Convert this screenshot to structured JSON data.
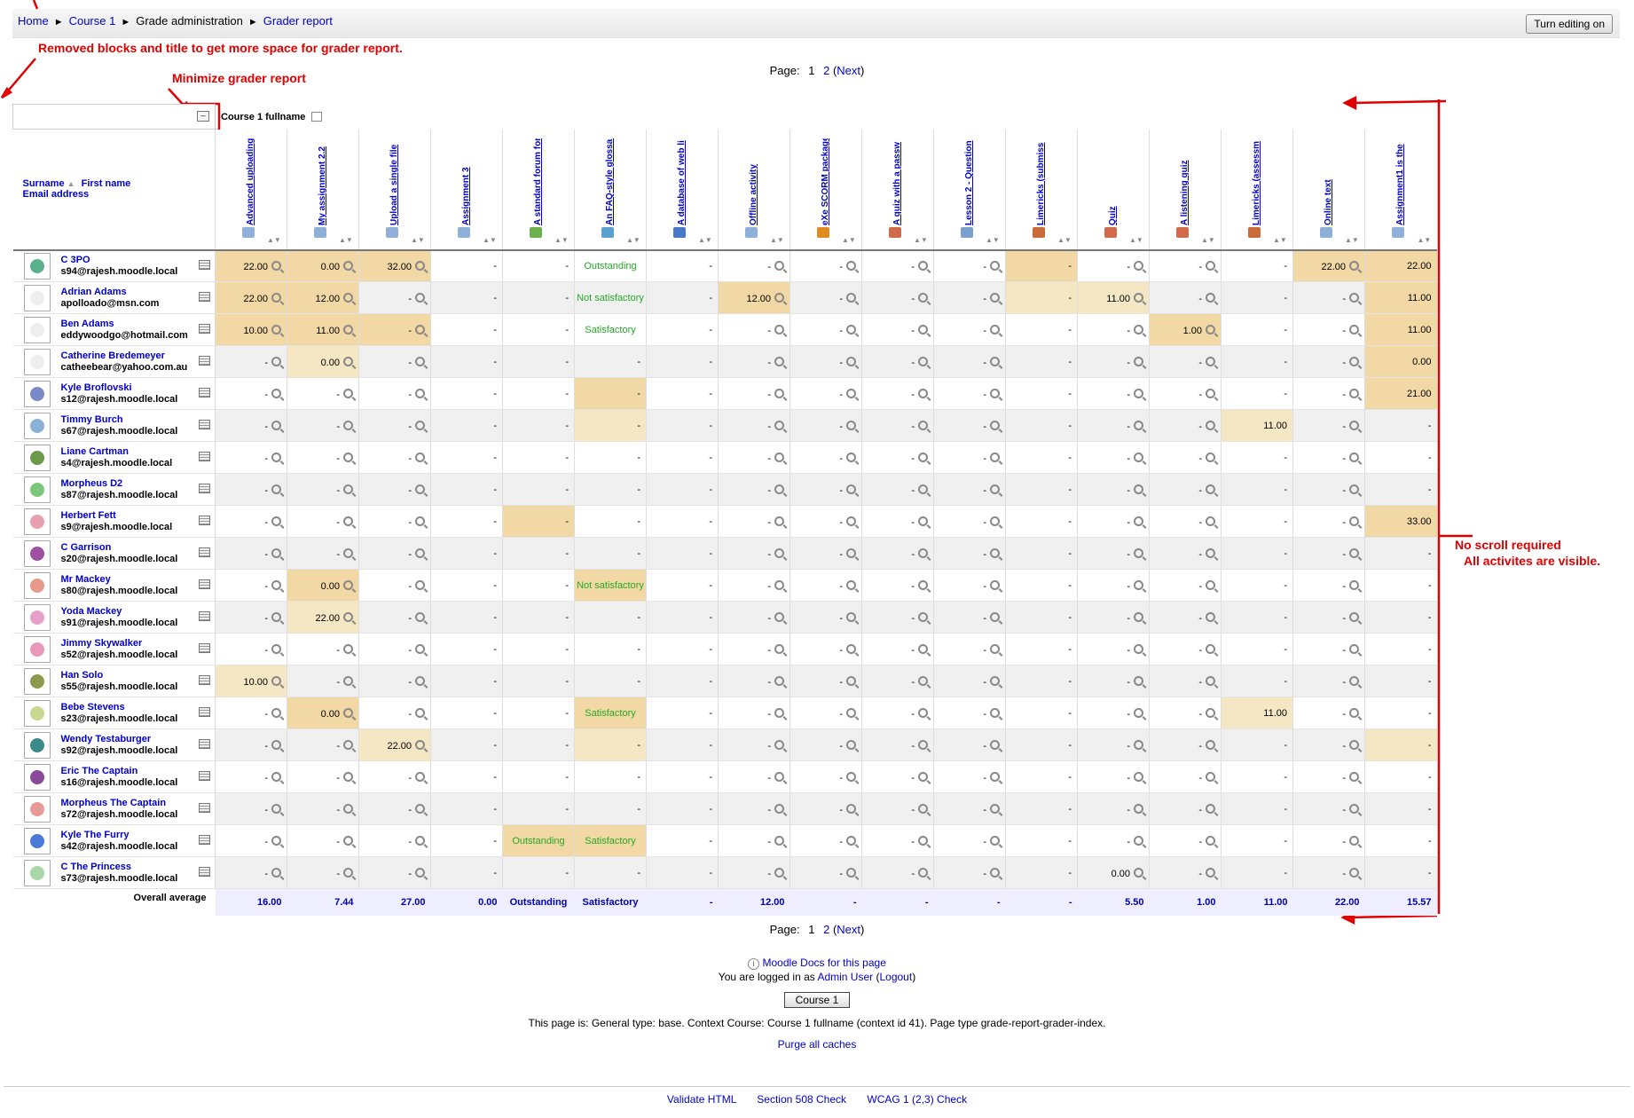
{
  "breadcrumb": [
    "Home",
    "Course 1",
    "Grade administration",
    "Grader report"
  ],
  "turn_editing_label": "Turn editing on",
  "annotations": {
    "removed_blocks": "Removed blocks and title to get more space for grader report.",
    "minimize": "Minimize grader report",
    "no_scroll_1": "No scroll required",
    "no_scroll_2": "All activites are visible."
  },
  "paging": {
    "label": "Page:",
    "current": "1",
    "page2": "2",
    "next": "Next"
  },
  "course_fullname": "Course 1 fullname",
  "user_header": {
    "surname": "Surname",
    "firstname": "First name",
    "email": "Email address"
  },
  "items": [
    {
      "name": "Advanced uploading",
      "icon_color": "#8fb0d8"
    },
    {
      "name": "My assignment 2.2",
      "icon_color": "#8fb0d8"
    },
    {
      "name": "Upload a single file",
      "icon_color": "#8fb0d8"
    },
    {
      "name": "Assignment 3",
      "icon_color": "#8fb0d8"
    },
    {
      "name": "A standard forum for",
      "icon_color": "#6bb04a"
    },
    {
      "name": "An FAQ-style glossary",
      "icon_color": "#5aa0d0"
    },
    {
      "name": "A database of web li",
      "icon_color": "#4a78c8"
    },
    {
      "name": "Offline activity",
      "icon_color": "#8fb0d8"
    },
    {
      "name": "eXe SCORM package",
      "icon_color": "#e08a20"
    },
    {
      "name": "A quiz with a passw",
      "icon_color": "#d06a4a"
    },
    {
      "name": "Lesson 2 - Question",
      "icon_color": "#7aa0d0"
    },
    {
      "name": "Limericks (submiss",
      "icon_color": "#c86a3a"
    },
    {
      "name": "Quiz",
      "icon_color": "#d06a4a"
    },
    {
      "name": "A listening quiz",
      "icon_color": "#d06a4a"
    },
    {
      "name": "Limericks (assessm",
      "icon_color": "#c86a3a"
    },
    {
      "name": "Online text",
      "icon_color": "#8fb0d8"
    },
    {
      "name": "Assignment1 is the",
      "icon_color": "#8fb0d8"
    }
  ],
  "users": [
    {
      "name": "C 3PO",
      "email": "s94@rajesh.moodle.local",
      "avatar": "#5ab08a",
      "grades": [
        "22.00",
        "0.00",
        "32.00",
        "-",
        "-",
        "Outstanding",
        "-",
        "-",
        "-",
        "-",
        "-",
        "-",
        "-",
        "-",
        "-",
        "22.00",
        "22.00"
      ]
    },
    {
      "name": "Adrian Adams",
      "email": "apolloado@msn.com",
      "avatar": "#eeeeee",
      "grades": [
        "22.00",
        "12.00",
        "-",
        "-",
        "-",
        "Not satisfactory",
        "-",
        "12.00",
        "-",
        "-",
        "-",
        "-",
        "11.00",
        "-",
        "-",
        "-",
        "11.00"
      ]
    },
    {
      "name": "Ben Adams",
      "email": "eddywoodgo@hotmail.com",
      "avatar": "#eeeeee",
      "grades": [
        "10.00",
        "11.00",
        "-",
        "-",
        "-",
        "Satisfactory",
        "-",
        "-",
        "-",
        "-",
        "-",
        "-",
        "-",
        "1.00",
        "-",
        "-",
        "11.00"
      ]
    },
    {
      "name": "Catherine Bredemeyer",
      "email": "catheebear@yahoo.com.au",
      "avatar": "#eeeeee",
      "grades": [
        "-",
        "0.00",
        "-",
        "-",
        "-",
        "-",
        "-",
        "-",
        "-",
        "-",
        "-",
        "-",
        "-",
        "-",
        "-",
        "-",
        "0.00"
      ]
    },
    {
      "name": "Kyle Broflovski",
      "email": "s12@rajesh.moodle.local",
      "avatar": "#7a8ac8",
      "grades": [
        "-",
        "-",
        "-",
        "-",
        "-",
        "-",
        "-",
        "-",
        "-",
        "-",
        "-",
        "-",
        "-",
        "-",
        "-",
        "-",
        "21.00"
      ]
    },
    {
      "name": "Timmy Burch",
      "email": "s67@rajesh.moodle.local",
      "avatar": "#8ab0d8",
      "grades": [
        "-",
        "-",
        "-",
        "-",
        "-",
        "-",
        "-",
        "-",
        "-",
        "-",
        "-",
        "-",
        "-",
        "-",
        "11.00",
        "-",
        "-"
      ]
    },
    {
      "name": "Liane Cartman",
      "email": "s4@rajesh.moodle.local",
      "avatar": "#6a9a4a",
      "grades": [
        "-",
        "-",
        "-",
        "-",
        "-",
        "-",
        "-",
        "-",
        "-",
        "-",
        "-",
        "-",
        "-",
        "-",
        "-",
        "-",
        "-"
      ]
    },
    {
      "name": "Morpheus D2",
      "email": "s87@rajesh.moodle.local",
      "avatar": "#7ac87a",
      "grades": [
        "-",
        "-",
        "-",
        "-",
        "-",
        "-",
        "-",
        "-",
        "-",
        "-",
        "-",
        "-",
        "-",
        "-",
        "-",
        "-",
        "-"
      ]
    },
    {
      "name": "Herbert Fett",
      "email": "s9@rajesh.moodle.local",
      "avatar": "#e8a0b0",
      "grades": [
        "-",
        "-",
        "-",
        "-",
        "-",
        "-",
        "-",
        "-",
        "-",
        "-",
        "-",
        "-",
        "-",
        "-",
        "-",
        "-",
        "33.00"
      ]
    },
    {
      "name": "C Garrison",
      "email": "s20@rajesh.moodle.local",
      "avatar": "#a050a0",
      "grades": [
        "-",
        "-",
        "-",
        "-",
        "-",
        "-",
        "-",
        "-",
        "-",
        "-",
        "-",
        "-",
        "-",
        "-",
        "-",
        "-",
        "-"
      ]
    },
    {
      "name": "Mr Mackey",
      "email": "s80@rajesh.moodle.local",
      "avatar": "#e89a8a",
      "grades": [
        "-",
        "0.00",
        "-",
        "-",
        "-",
        "Not satisfactory",
        "-",
        "-",
        "-",
        "-",
        "-",
        "-",
        "-",
        "-",
        "-",
        "-",
        "-"
      ]
    },
    {
      "name": "Yoda Mackey",
      "email": "s91@rajesh.moodle.local",
      "avatar": "#e8a0c8",
      "grades": [
        "-",
        "22.00",
        "-",
        "-",
        "-",
        "-",
        "-",
        "-",
        "-",
        "-",
        "-",
        "-",
        "-",
        "-",
        "-",
        "-",
        "-"
      ]
    },
    {
      "name": "Jimmy Skywalker",
      "email": "s52@rajesh.moodle.local",
      "avatar": "#e898b8",
      "grades": [
        "-",
        "-",
        "-",
        "-",
        "-",
        "-",
        "-",
        "-",
        "-",
        "-",
        "-",
        "-",
        "-",
        "-",
        "-",
        "-",
        "-"
      ]
    },
    {
      "name": "Han Solo",
      "email": "s55@rajesh.moodle.local",
      "avatar": "#8a9a4a",
      "grades": [
        "10.00",
        "-",
        "-",
        "-",
        "-",
        "-",
        "-",
        "-",
        "-",
        "-",
        "-",
        "-",
        "-",
        "-",
        "-",
        "-",
        "-"
      ]
    },
    {
      "name": "Bebe Stevens",
      "email": "s23@rajesh.moodle.local",
      "avatar": "#c8d890",
      "grades": [
        "-",
        "0.00",
        "-",
        "-",
        "-",
        "Satisfactory",
        "-",
        "-",
        "-",
        "-",
        "-",
        "-",
        "-",
        "-",
        "11.00",
        "-",
        "-"
      ]
    },
    {
      "name": "Wendy Testaburger",
      "email": "s92@rajesh.moodle.local",
      "avatar": "#3a8a8a",
      "grades": [
        "-",
        "-",
        "22.00",
        "-",
        "-",
        "-",
        "-",
        "-",
        "-",
        "-",
        "-",
        "-",
        "-",
        "-",
        "-",
        "-",
        "-"
      ]
    },
    {
      "name": "Eric The Captain",
      "email": "s16@rajesh.moodle.local",
      "avatar": "#8a4a9a",
      "grades": [
        "-",
        "-",
        "-",
        "-",
        "-",
        "-",
        "-",
        "-",
        "-",
        "-",
        "-",
        "-",
        "-",
        "-",
        "-",
        "-",
        "-"
      ]
    },
    {
      "name": "Morpheus The Captain",
      "email": "s72@rajesh.moodle.local",
      "avatar": "#e89898",
      "grades": [
        "-",
        "-",
        "-",
        "-",
        "-",
        "-",
        "-",
        "-",
        "-",
        "-",
        "-",
        "-",
        "-",
        "-",
        "-",
        "-",
        "-"
      ]
    },
    {
      "name": "Kyle The Furry",
      "email": "s42@rajesh.moodle.local",
      "avatar": "#4a7ad8",
      "grades": [
        "-",
        "-",
        "-",
        "-",
        "Outstanding",
        "Satisfactory",
        "-",
        "-",
        "-",
        "-",
        "-",
        "-",
        "-",
        "-",
        "-",
        "-",
        "-"
      ]
    },
    {
      "name": "C The Princess",
      "email": "s73@rajesh.moodle.local",
      "avatar": "#a8d8a8",
      "grades": [
        "-",
        "-",
        "-",
        "-",
        "-",
        "-",
        "-",
        "-",
        "-",
        "-",
        "-",
        "-",
        "0.00",
        "-",
        "-",
        "-",
        "-"
      ]
    }
  ],
  "overall_average": {
    "label": "Overall average",
    "values": [
      "16.00",
      "7.44",
      "27.00",
      "0.00",
      "Outstanding",
      "Satisfactory",
      "-",
      "12.00",
      "-",
      "-",
      "-",
      "-",
      "5.50",
      "1.00",
      "11.00",
      "22.00",
      "15.57"
    ]
  },
  "footer": {
    "docs_link": "Moodle Docs for this page",
    "logged_in_prefix": "You are logged in as",
    "user": "Admin User",
    "logout": "Logout",
    "course_button": "Course 1",
    "page_info": "This page is: General type: base. Context Course: Course 1 fullname (context id 41). Page type grade-report-grader-index.",
    "purge": "Purge all caches",
    "validate": "Validate HTML",
    "section508": "Section 508 Check",
    "wcag": "WCAG 1 (2,3) Check"
  },
  "colors": {
    "annotation": "#e00000",
    "link": "#0000cc",
    "overridden": "#f2d8a4",
    "scale_text": "#22aa22",
    "average_bg": "#eeeeff"
  }
}
